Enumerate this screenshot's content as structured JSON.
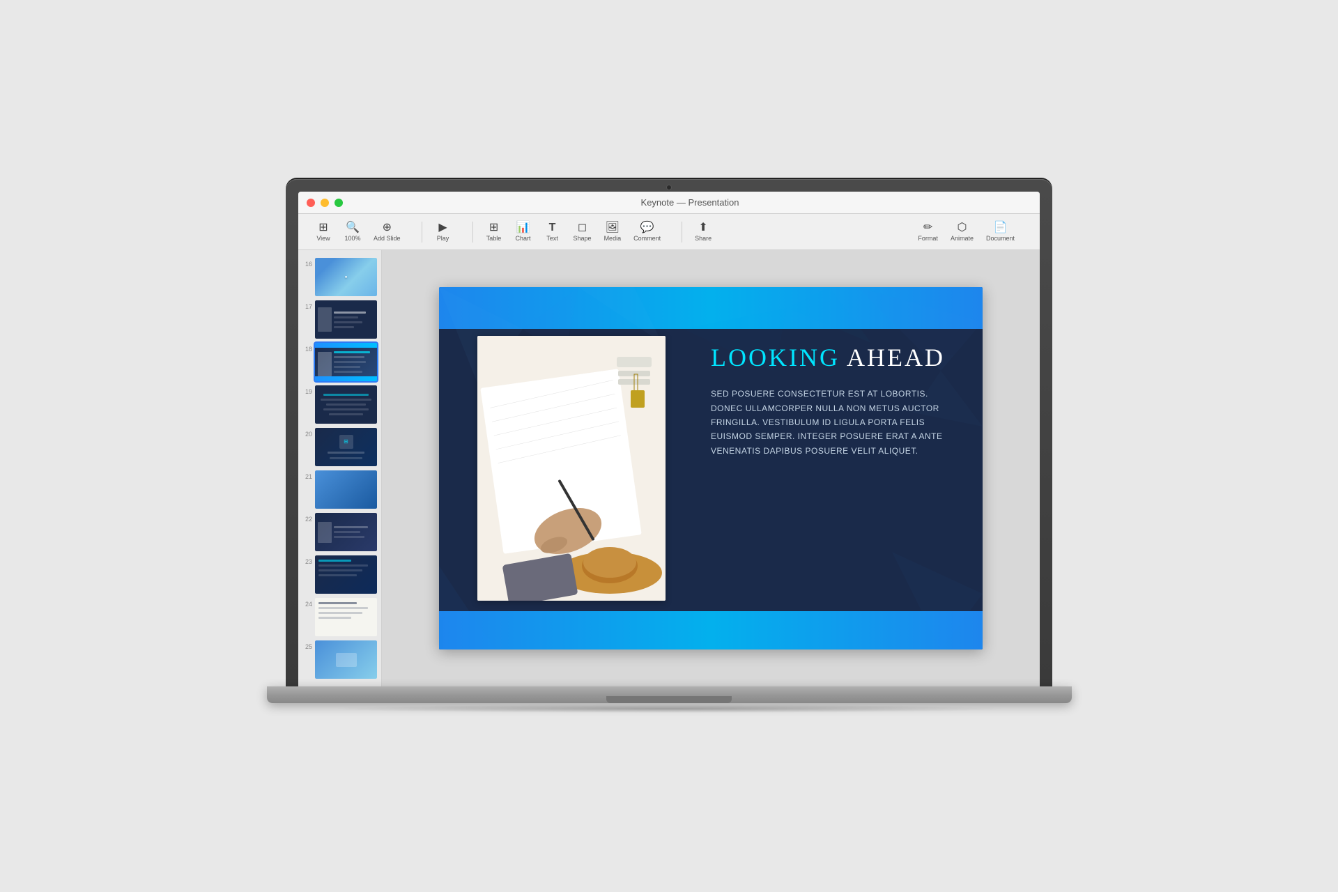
{
  "app": {
    "title": "Keynote — Presentation",
    "window_controls": {
      "close": "●",
      "minimize": "●",
      "maximize": "●"
    }
  },
  "toolbar": {
    "view_label": "View",
    "zoom_label": "100%",
    "zoom_value": "100%",
    "add_slide_label": "Add Slide",
    "play_label": "Play",
    "table_label": "Table",
    "chart_label": "Chart",
    "text_label": "Text",
    "shape_label": "Shape",
    "media_label": "Media",
    "comment_label": "Comment",
    "share_label": "Share",
    "format_label": "Format",
    "animate_label": "Animate",
    "document_label": "Document"
  },
  "slide_panel": {
    "slides": [
      {
        "number": "16",
        "style": "mini-slide-16"
      },
      {
        "number": "17",
        "style": "mini-slide-17"
      },
      {
        "number": "18",
        "style": "mini-slide-18",
        "active": true
      },
      {
        "number": "19",
        "style": "mini-slide-19"
      },
      {
        "number": "20",
        "style": "mini-slide-20"
      },
      {
        "number": "21",
        "style": "mini-slide-21"
      },
      {
        "number": "22",
        "style": "mini-slide-22"
      },
      {
        "number": "23",
        "style": "mini-slide-23"
      },
      {
        "number": "24",
        "style": "mini-slide-24"
      },
      {
        "number": "25",
        "style": "mini-slide-25"
      }
    ]
  },
  "current_slide": {
    "title_part1": "Looking ",
    "title_part2": "Ahead",
    "body_text": "Sed posuere consectetur est at lobortis. Donec ullamcorper nulla non metus auctor fringilla. Vestibulum id ligula porta felis euismod semper. Integer posuere erat a ante venenatis dapibus posuere velit aliquet."
  },
  "icons": {
    "view": "⊞",
    "zoom": "🔍",
    "add_slide": "⊕",
    "play": "▶",
    "table": "⊞",
    "chart": "📊",
    "text": "T",
    "shape": "◻",
    "media": "🖼",
    "comment": "💬",
    "share": "⬆",
    "format": "✏",
    "animate": "⬡",
    "document": "📄"
  }
}
